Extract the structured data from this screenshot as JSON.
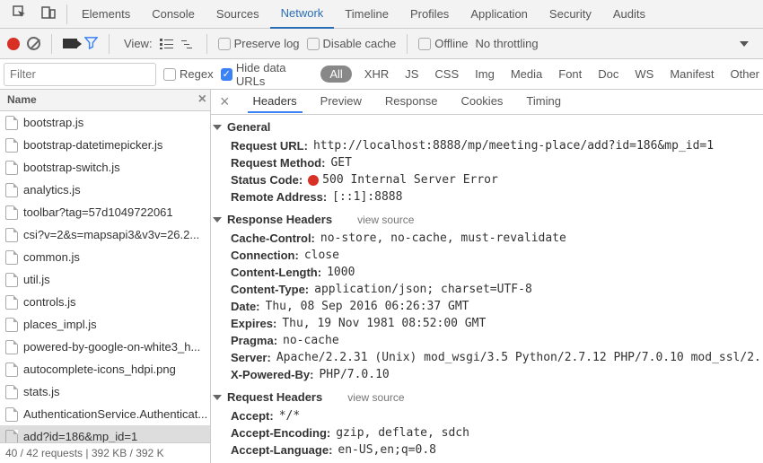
{
  "top_tabs": [
    "Elements",
    "Console",
    "Sources",
    "Network",
    "Timeline",
    "Profiles",
    "Application",
    "Security",
    "Audits"
  ],
  "top_active": "Network",
  "toolbar": {
    "view_label": "View:",
    "preserve_log": "Preserve log",
    "disable_cache": "Disable cache",
    "offline": "Offline",
    "throttle": "No throttling"
  },
  "filter": {
    "placeholder": "Filter",
    "regex": "Regex",
    "hide_data": "Hide data URLs",
    "types": [
      "All",
      "XHR",
      "JS",
      "CSS",
      "Img",
      "Media",
      "Font",
      "Doc",
      "WS",
      "Manifest",
      "Other"
    ],
    "type_active": "All"
  },
  "left_header": "Name",
  "selected_file": "add?id=186&mp_id=1",
  "files": [
    "bootstrap.js",
    "bootstrap-datetimepicker.js",
    "bootstrap-switch.js",
    "analytics.js",
    "toolbar?tag=57d1049722061",
    "csi?v=2&s=mapsapi3&v3v=26.2...",
    "common.js",
    "util.js",
    "controls.js",
    "places_impl.js",
    "powered-by-google-on-white3_h...",
    "autocomplete-icons_hdpi.png",
    "stats.js",
    "AuthenticationService.Authenticat...",
    "add?id=186&mp_id=1"
  ],
  "footer_status": "40 / 42 requests  |  392 KB / 392 K",
  "right_tabs": [
    "Headers",
    "Preview",
    "Response",
    "Cookies",
    "Timing"
  ],
  "right_active": "Headers",
  "sections": {
    "general": {
      "title": "General",
      "rows": [
        {
          "key": "Request URL:",
          "val": "http://localhost:8888/mp/meeting-place/add?id=186&mp_id=1"
        },
        {
          "key": "Request Method:",
          "val": "GET"
        },
        {
          "key": "Status Code:",
          "val": "500 Internal Server Error",
          "status": true
        },
        {
          "key": "Remote Address:",
          "val": "[::1]:8888"
        }
      ]
    },
    "response_headers": {
      "title": "Response Headers",
      "view_source": "view source",
      "rows": [
        {
          "key": "Cache-Control:",
          "val": "no-store, no-cache, must-revalidate"
        },
        {
          "key": "Connection:",
          "val": "close"
        },
        {
          "key": "Content-Length:",
          "val": "1000"
        },
        {
          "key": "Content-Type:",
          "val": "application/json; charset=UTF-8"
        },
        {
          "key": "Date:",
          "val": "Thu, 08 Sep 2016 06:26:37 GMT"
        },
        {
          "key": "Expires:",
          "val": "Thu, 19 Nov 1981 08:52:00 GMT"
        },
        {
          "key": "Pragma:",
          "val": "no-cache"
        },
        {
          "key": "Server:",
          "val": "Apache/2.2.31 (Unix) mod_wsgi/3.5 Python/2.7.12 PHP/7.0.10 mod_ssl/2."
        },
        {
          "key": "X-Powered-By:",
          "val": "PHP/7.0.10"
        }
      ]
    },
    "request_headers": {
      "title": "Request Headers",
      "view_source": "view source",
      "rows": [
        {
          "key": "Accept:",
          "val": "*/*"
        },
        {
          "key": "Accept-Encoding:",
          "val": "gzip, deflate, sdch"
        },
        {
          "key": "Accept-Language:",
          "val": "en-US,en;q=0.8"
        }
      ]
    }
  }
}
